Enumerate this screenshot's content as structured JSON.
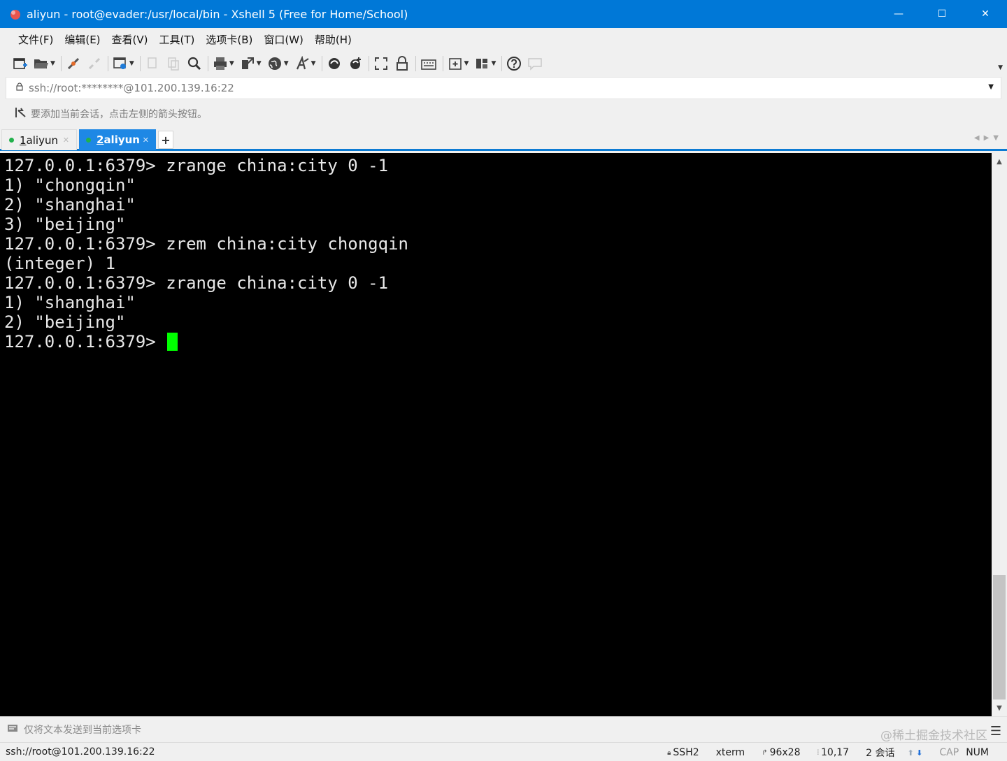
{
  "window": {
    "title": "aliyun - root@evader:/usr/local/bin - Xshell 5 (Free for Home/School)",
    "accent": "#0078d7",
    "controls": {
      "minimize": "—",
      "maximize": "☐",
      "close": "✕"
    }
  },
  "menu": {
    "items": [
      "文件(F)",
      "编辑(E)",
      "查看(V)",
      "工具(T)",
      "选项卡(B)",
      "窗口(W)",
      "帮助(H)"
    ]
  },
  "toolbar": {
    "icons": [
      "new-session-icon",
      "open-folder-icon",
      "reconnect-icon",
      "disconnect-icon",
      "properties-icon",
      "copy-icon",
      "paste-icon",
      "find-icon",
      "print-icon",
      "transfer-icon",
      "globe-icon",
      "font-icon",
      "xftp-icon",
      "xftp-new-icon",
      "fullscreen-icon",
      "lock-icon",
      "keyboard-icon",
      "add-tab-icon",
      "layout-icon",
      "help-icon",
      "chat-icon"
    ]
  },
  "address": {
    "value": "ssh://root:********@101.200.139.16:22"
  },
  "hint": {
    "text": "要添加当前会话，点击左侧的箭头按钮。"
  },
  "tabs": [
    {
      "number": "1",
      "label": " aliyun",
      "active": false
    },
    {
      "number": "2",
      "label": " aliyun",
      "active": true
    }
  ],
  "tab_add_label": "+",
  "terminal": {
    "lines": [
      "127.0.0.1:6379> zrange china:city 0 -1",
      "1) \"chongqin\"",
      "2) \"shanghai\"",
      "3) \"beijing\"",
      "127.0.0.1:6379> zrem china:city chongqin",
      "(integer) 1",
      "127.0.0.1:6379> zrange china:city 0 -1",
      "1) \"shanghai\"",
      "2) \"beijing\""
    ],
    "prompt": "127.0.0.1:6379> ",
    "cursor_color": "#00ff00"
  },
  "compose": {
    "text": "仅将文本发送到当前选项卡",
    "watermark": "@稀土掘金技术社区"
  },
  "status": {
    "connection": "ssh://root@101.200.139.16:22",
    "protocol": "SSH2",
    "terminal_type": "xterm",
    "size": "96x28",
    "cursor_pos": "10,17",
    "sessions": "2 会话",
    "caps": "CAP",
    "num": "NUM"
  }
}
